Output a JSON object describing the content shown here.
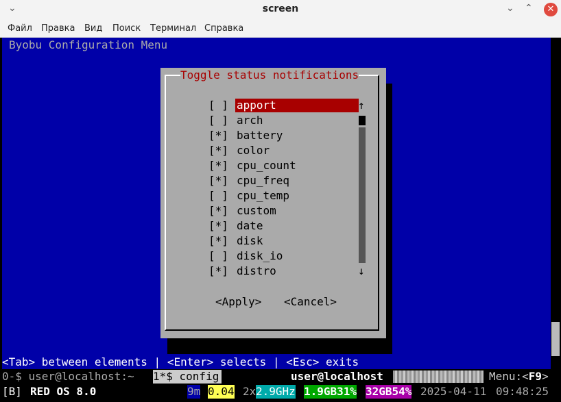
{
  "window": {
    "title": "screen"
  },
  "menubar": [
    "Файл",
    "Правка",
    "Вид",
    "Поиск",
    "Терминал",
    "Справка"
  ],
  "terminal": {
    "header": "Byobu Configuration Menu",
    "dialog": {
      "title": "Toggle status notifications",
      "items": [
        {
          "check": "[ ]",
          "label": "apport",
          "selected": true
        },
        {
          "check": "[ ]",
          "label": "arch"
        },
        {
          "check": "[*]",
          "label": "battery"
        },
        {
          "check": "[*]",
          "label": "color"
        },
        {
          "check": "[*]",
          "label": "cpu_count"
        },
        {
          "check": "[*]",
          "label": "cpu_freq"
        },
        {
          "check": "[ ]",
          "label": "cpu_temp"
        },
        {
          "check": "[*]",
          "label": "custom"
        },
        {
          "check": "[*]",
          "label": "date"
        },
        {
          "check": "[*]",
          "label": "disk"
        },
        {
          "check": "[ ]",
          "label": "disk_io"
        },
        {
          "check": "[*]",
          "label": "distro"
        }
      ],
      "arrow_up": "↑",
      "arrow_down": "↓",
      "apply": "<Apply>",
      "cancel": "<Cancel>"
    },
    "hint": "<Tab> between elements | <Enter> selects | <Esc> exits",
    "status1": {
      "win0": "0-$ user@localhost:~",
      "win1": "1*$ config",
      "host": "user@localhost",
      "menu": "Menu:<",
      "menu_key": "F9",
      "menu_end": ">"
    },
    "status2": {
      "session": "[B]",
      "os": "RED OS 8.0",
      "uptime": "9m",
      "load": "0.04",
      "cpu_count": "2x",
      "cpu_freq": "2.9GHz",
      "mem": "1.9GB31%",
      "disk": "32GB54%",
      "date": "2025-04-11",
      "time": "09:48:25"
    }
  },
  "colors": {
    "terminal_bg": "#0000a8",
    "dialog_bg": "#aaaaaa",
    "selection": "#a80000",
    "close_button": "#e04a3f"
  }
}
